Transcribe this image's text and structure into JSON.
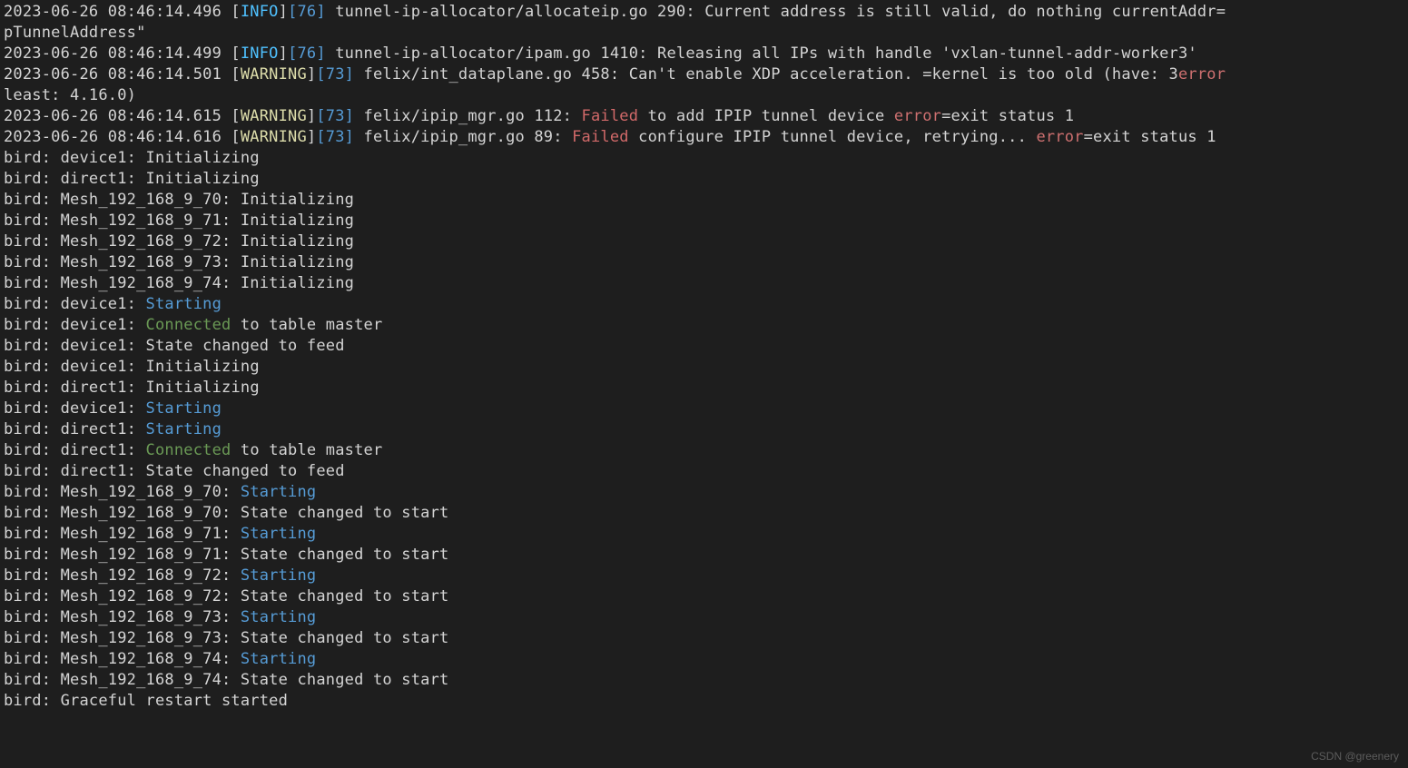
{
  "watermark": "CSDN @greenery",
  "lines": [
    {
      "type": "log",
      "ts": "2023-06-26 08:46:14.496",
      "level": "INFO",
      "thread": "76",
      "text": " tunnel-ip-allocator/allocateip.go 290: Current address is still valid, do nothing currentAddr="
    },
    {
      "type": "plain",
      "text": "pTunnelAddress\""
    },
    {
      "type": "log",
      "ts": "2023-06-26 08:46:14.499",
      "level": "INFO",
      "thread": "76",
      "text": " tunnel-ip-allocator/ipam.go 1410: Releasing all IPs with handle 'vxlan-tunnel-addr-worker3'"
    },
    {
      "type": "log",
      "ts": "2023-06-26 08:46:14.501",
      "level": "WARNING",
      "thread": "73",
      "text": " felix/int_dataplane.go 458: Can't enable XDP acceleration. ",
      "errLabel": "error",
      "after": "=kernel is too old (have: 3"
    },
    {
      "type": "plain",
      "text": "least: 4.16.0)"
    },
    {
      "type": "log",
      "ts": "2023-06-26 08:46:14.615",
      "level": "WARNING",
      "thread": "73",
      "text": " felix/ipip_mgr.go 112: ",
      "failed": "Failed",
      "after": " to add IPIP tunnel device ",
      "errLabel": "error",
      "after2": "=exit status 1"
    },
    {
      "type": "log",
      "ts": "2023-06-26 08:46:14.616",
      "level": "WARNING",
      "thread": "73",
      "text": " felix/ipip_mgr.go 89: ",
      "failed": "Failed",
      "after": " configure IPIP tunnel device, retrying... ",
      "errLabel": "error",
      "after2": "=exit status 1"
    },
    {
      "type": "bird",
      "prefix": "bird: device1: ",
      "state": "plain",
      "suffix": "Initializing"
    },
    {
      "type": "bird",
      "prefix": "bird: direct1: ",
      "state": "plain",
      "suffix": "Initializing"
    },
    {
      "type": "bird",
      "prefix": "bird: Mesh_192_168_9_70: ",
      "state": "plain",
      "suffix": "Initializing"
    },
    {
      "type": "bird",
      "prefix": "bird: Mesh_192_168_9_71: ",
      "state": "plain",
      "suffix": "Initializing"
    },
    {
      "type": "bird",
      "prefix": "bird: Mesh_192_168_9_72: ",
      "state": "plain",
      "suffix": "Initializing"
    },
    {
      "type": "bird",
      "prefix": "bird: Mesh_192_168_9_73: ",
      "state": "plain",
      "suffix": "Initializing"
    },
    {
      "type": "bird",
      "prefix": "bird: Mesh_192_168_9_74: ",
      "state": "plain",
      "suffix": "Initializing"
    },
    {
      "type": "bird",
      "prefix": "bird: device1: ",
      "state": "start",
      "suffix": "Starting"
    },
    {
      "type": "bird",
      "prefix": "bird: device1: ",
      "state": "connect",
      "suffix": "Connected",
      "tail": " to table master"
    },
    {
      "type": "bird",
      "prefix": "bird: device1: ",
      "state": "plain",
      "suffix": "State changed to feed"
    },
    {
      "type": "bird",
      "prefix": "bird: device1: ",
      "state": "plain",
      "suffix": "Initializing"
    },
    {
      "type": "bird",
      "prefix": "bird: direct1: ",
      "state": "plain",
      "suffix": "Initializing"
    },
    {
      "type": "bird",
      "prefix": "bird: device1: ",
      "state": "start",
      "suffix": "Starting"
    },
    {
      "type": "bird",
      "prefix": "bird: direct1: ",
      "state": "start",
      "suffix": "Starting"
    },
    {
      "type": "bird",
      "prefix": "bird: direct1: ",
      "state": "connect",
      "suffix": "Connected",
      "tail": " to table master"
    },
    {
      "type": "bird",
      "prefix": "bird: direct1: ",
      "state": "plain",
      "suffix": "State changed to feed"
    },
    {
      "type": "bird",
      "prefix": "bird: Mesh_192_168_9_70: ",
      "state": "start",
      "suffix": "Starting"
    },
    {
      "type": "bird",
      "prefix": "bird: Mesh_192_168_9_70: ",
      "state": "plain",
      "suffix": "State changed to start"
    },
    {
      "type": "bird",
      "prefix": "bird: Mesh_192_168_9_71: ",
      "state": "start",
      "suffix": "Starting"
    },
    {
      "type": "bird",
      "prefix": "bird: Mesh_192_168_9_71: ",
      "state": "plain",
      "suffix": "State changed to start"
    },
    {
      "type": "bird",
      "prefix": "bird: Mesh_192_168_9_72: ",
      "state": "start",
      "suffix": "Starting"
    },
    {
      "type": "bird",
      "prefix": "bird: Mesh_192_168_9_72: ",
      "state": "plain",
      "suffix": "State changed to start"
    },
    {
      "type": "bird",
      "prefix": "bird: Mesh_192_168_9_73: ",
      "state": "start",
      "suffix": "Starting"
    },
    {
      "type": "bird",
      "prefix": "bird: Mesh_192_168_9_73: ",
      "state": "plain",
      "suffix": "State changed to start"
    },
    {
      "type": "bird",
      "prefix": "bird: Mesh_192_168_9_74: ",
      "state": "start",
      "suffix": "Starting"
    },
    {
      "type": "bird",
      "prefix": "bird: Mesh_192_168_9_74: ",
      "state": "plain",
      "suffix": "State changed to start"
    },
    {
      "type": "bird",
      "prefix": "bird: ",
      "state": "plain",
      "suffix": "Graceful restart started"
    }
  ]
}
